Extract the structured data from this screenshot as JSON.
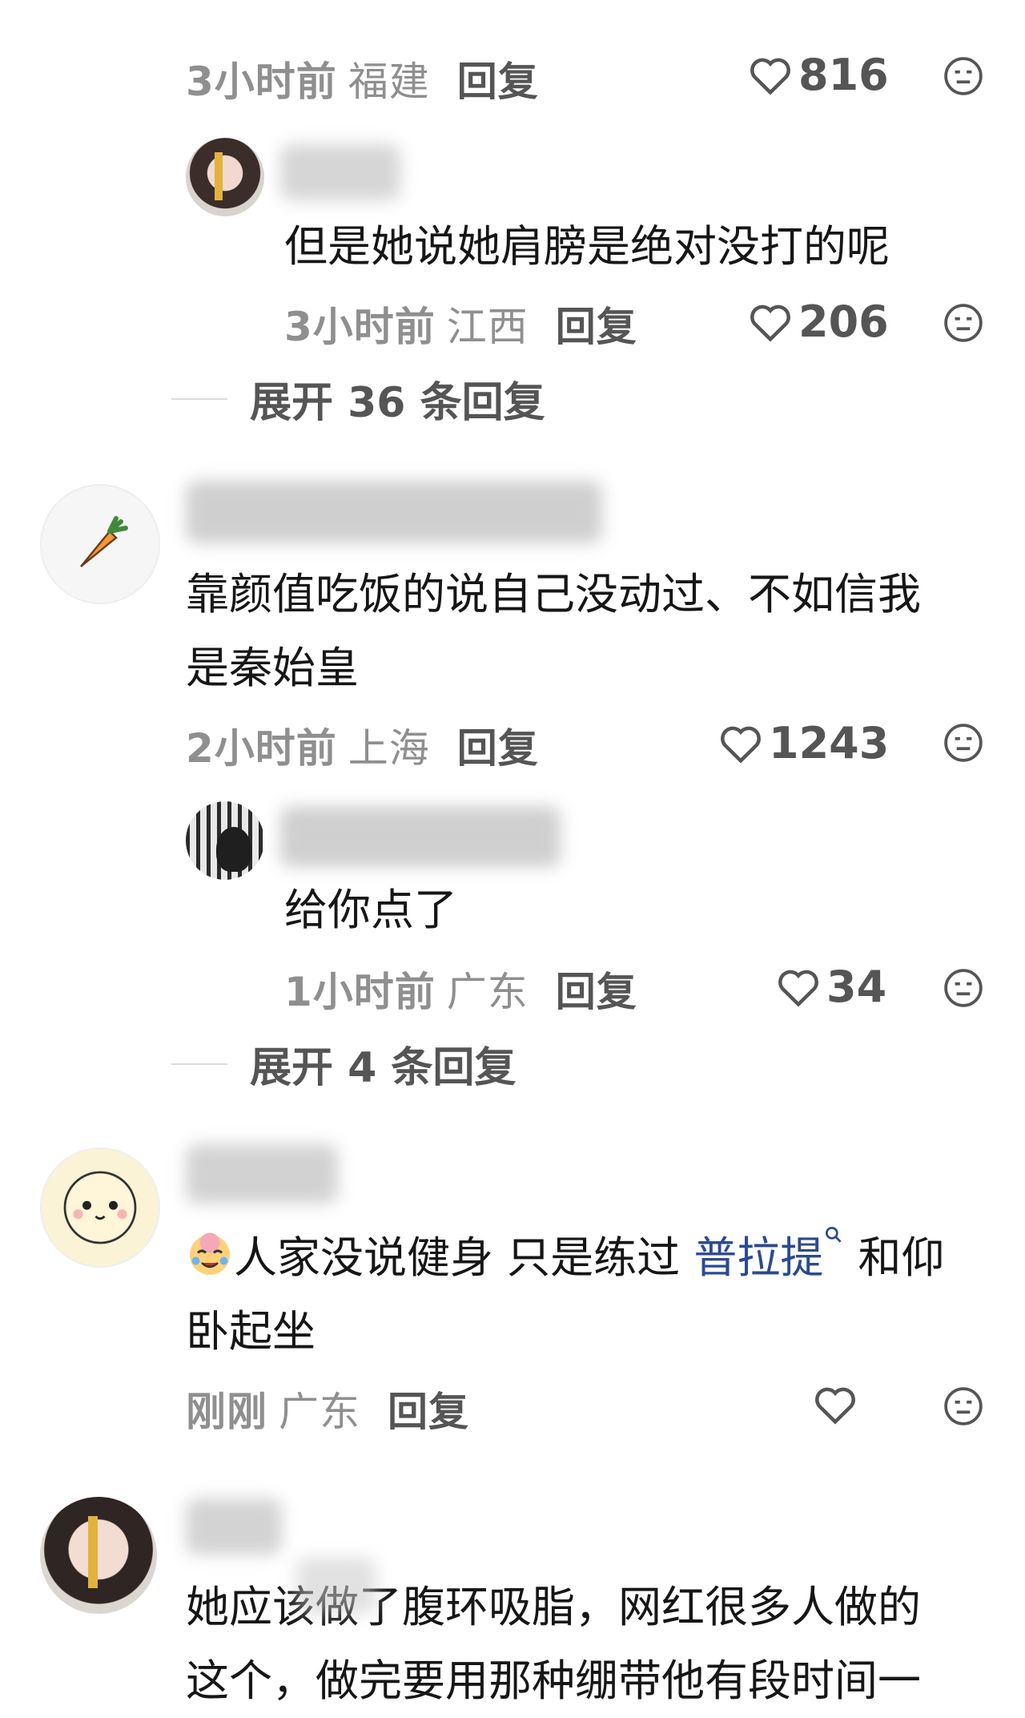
{
  "colors": {
    "text": "#161616",
    "meta": "#8f8f8f",
    "link": "#2b4a8f"
  },
  "icons": {
    "like": "heart-outline-icon",
    "dislike": "meh-face-icon"
  },
  "rows": {
    "r1": {
      "time": "3小时前",
      "loc": "福建",
      "reply": "回复",
      "likes": "816"
    },
    "reply1": {
      "text": "但是她说她肩膀是绝对没打的呢",
      "time": "3小时前",
      "loc": "江西",
      "reply": "回复",
      "likes": "206"
    },
    "expand1": "展开 36 条回复",
    "c2": {
      "line1": "靠颜值吃饭的说自己没动过、不如信我",
      "line2": "是秦始皇",
      "time": "2小时前",
      "loc": "上海",
      "reply": "回复",
      "likes": "1243"
    },
    "reply2": {
      "text": "给你点了",
      "time": "1小时前",
      "loc": "广东",
      "reply": "回复",
      "likes": "34"
    },
    "expand2": "展开 4 条回复",
    "c3": {
      "part1": "人家没说健身 只是练过 ",
      "link": "普拉提",
      "part2": " 和仰",
      "line2": "卧起坐",
      "time": "刚刚",
      "loc": "广东",
      "reply": "回复"
    },
    "c4": {
      "line1": "她应该做了腹环吸脂，网红很多人做的",
      "line2": "这个，做完要用那种绷带他有段时间一"
    }
  }
}
